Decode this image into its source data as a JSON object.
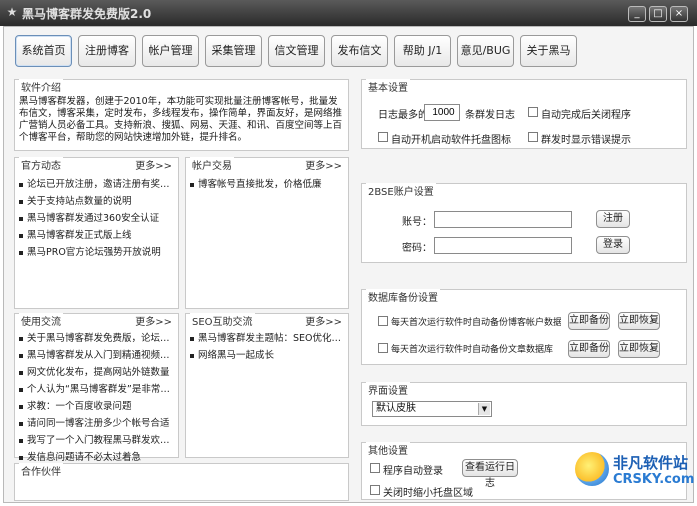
{
  "window": {
    "title": "黑马博客群发免费版2.0",
    "app_icon": "star-icon"
  },
  "window_buttons": {
    "minimize": "_",
    "maximize": "□",
    "close": "×"
  },
  "nav": [
    {
      "label": "系统首页"
    },
    {
      "label": "注册博客"
    },
    {
      "label": "帐户管理"
    },
    {
      "label": "采集管理"
    },
    {
      "label": "信文管理"
    },
    {
      "label": "发布信文"
    },
    {
      "label": "帮助 J/1"
    },
    {
      "label": "意见/BUG"
    },
    {
      "label": "关于黑马"
    }
  ],
  "intro": {
    "title": "软件介绍",
    "text": "黑马博客群发器，创建于2010年，本功能可实现批量注册博客帐号，批量发布信文，博客采集，定时发布，多线程发布，操作简单，界面友好，是网络推广营销人员必备工具。支持新浪、搜狐、网易、天涯、和讯、百度空间等上百个博客平台，帮助您的网站快速增加外链，提升排名。"
  },
  "official": {
    "title": "官方动态",
    "more": "更多>>",
    "items": [
      "论坛已开放注册，邀请注册有奖，详情请看论坛",
      "关于支持站点数量的说明",
      "黑马博客群发通过360安全认证",
      "黑马博客群发正式版上线",
      "黑马PRO官方论坛强势开放说明"
    ]
  },
  "account_trade": {
    "title": "帐户交易",
    "more": "更多>>",
    "items": [
      "博客帐号直接批发，价格低廉"
    ]
  },
  "usage": {
    "title": "使用交流",
    "more": "更多>>",
    "items": [
      "关于黑马博客群发免费版，论坛交流",
      "黑马博客群发从入门到精通视频教程",
      "网文优化发布，提高网站外链数量",
      "个人认为“黑马博客群发”是非常好用的工具",
      "求教：一个百度收录问题",
      "请问同一博客注册多少个帐号合适",
      "我写了一个入门教程黑马群发欢迎交流",
      "发信息问题请不必太过着急"
    ]
  },
  "seo": {
    "title": "SEO互助交流",
    "more": "更多>>",
    "items": [
      "黑马博客群发主题帖：SEO优化技巧分享",
      "网络黑马一起成长"
    ]
  },
  "cooperation": {
    "title": "合作伙伴"
  },
  "basic": {
    "title": "基本设置",
    "log_prefix": "日志最多的",
    "log_value": "1000",
    "log_suffix": "条群发日志",
    "chk_auto_out": "自动完成后关闭程序",
    "chk_bg_start": "自动开机启动软件托盘图标",
    "chk_error_mode": "群发时显示错误提示"
  },
  "platform": {
    "title": "2BSE账户设置",
    "user_label": "账号：",
    "user_value": "",
    "pass_label": "密码：",
    "pass_value": "",
    "register_btn": "注册",
    "login_btn": "登录"
  },
  "backup": {
    "title": "数据库备份设置",
    "row1_label": "每天首次运行软件时自动备份博客帐户数据库",
    "row2_label": "每天首次运行软件时自动备份文章数据库",
    "backup_now": "立即备份",
    "restore_now": "立即恢复"
  },
  "ui": {
    "title": "界面设置",
    "skin_selected": "默认皮肤"
  },
  "other": {
    "title": "其他设置",
    "chk_auto_login": "程序自动登录",
    "view_log_btn": "查看运行日志",
    "chk_close_tray": "关闭时缩小托盘区域"
  },
  "watermark": {
    "name": "非凡软件站",
    "domain": "CRSKY.com"
  }
}
